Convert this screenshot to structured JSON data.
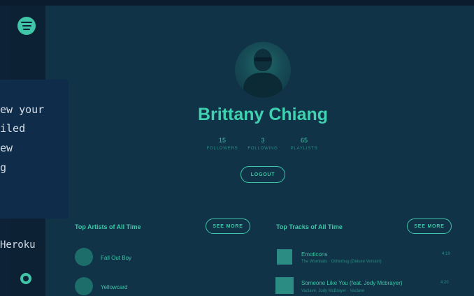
{
  "profile": {
    "name": "Brittany Chiang",
    "stats": [
      {
        "value": "15",
        "label": "FOLLOWERS"
      },
      {
        "value": "3",
        "label": "FOLLOWING"
      },
      {
        "value": "65",
        "label": "PLAYLISTS"
      }
    ],
    "logout_label": "LOGOUT"
  },
  "top_artists": {
    "title": "Top Artists of All Time",
    "see_more": "SEE MORE",
    "items": [
      {
        "name": "Fall Out Boy"
      },
      {
        "name": "Yellowcard"
      }
    ]
  },
  "top_tracks": {
    "title": "Top Tracks of All Time",
    "see_more": "SEE MORE",
    "items": [
      {
        "title": "Emoticons",
        "subtitle": "The Wombats · Glitterbug (Deluxe Version)",
        "duration": "4:19"
      },
      {
        "title": "Someone Like You (feat. Jody Mcbrayer)",
        "subtitle": "Vaclave, Jody McBrayer · Vaclave",
        "duration": "4:20"
      }
    ]
  },
  "overlay": {
    "lines": [
      "ew your",
      "iled",
      "ew",
      "g"
    ],
    "heroku": "Heroku"
  },
  "icons": {
    "logo": "spotify-icon",
    "github": "github-icon"
  }
}
